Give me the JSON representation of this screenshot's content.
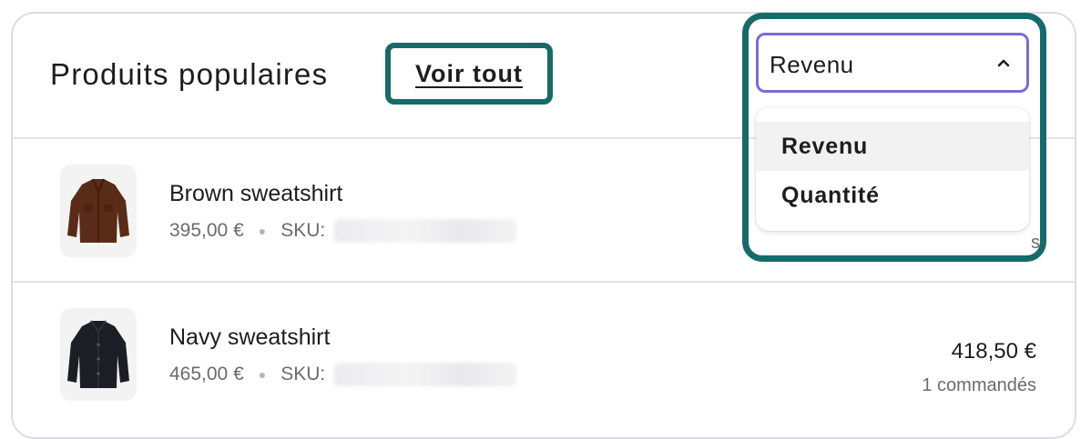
{
  "header": {
    "title": "Produits populaires",
    "view_all_label": "Voir tout"
  },
  "sort_select": {
    "value": "Revenu",
    "options": [
      "Revenu",
      "Quantité"
    ],
    "selected_index": 0,
    "chevron_icon": "chevron-up-icon"
  },
  "products": [
    {
      "name": "Brown sweatshirt",
      "price": "395,00 €",
      "sku_label": "SKU:",
      "sku_value_hidden": true,
      "revenue": "",
      "orders": "",
      "edge_glyph": "s",
      "image_icon": "brown-jacket-icon"
    },
    {
      "name": "Navy sweatshirt",
      "price": "465,00 €",
      "sku_label": "SKU:",
      "sku_value_hidden": true,
      "revenue": "418,50 €",
      "orders": "1 commandés",
      "image_icon": "navy-jacket-icon"
    }
  ],
  "colors": {
    "focus_ring": "#156b6a",
    "select_border": "#7b6bd6",
    "brown_product": "#5a2c17",
    "navy_product": "#1c1e26"
  }
}
